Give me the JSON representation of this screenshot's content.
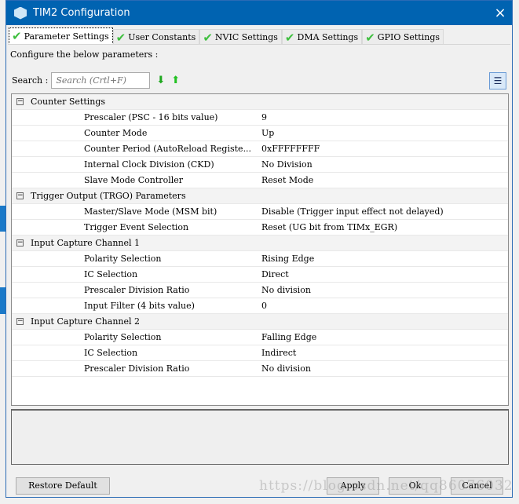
{
  "window": {
    "title": "TIM2 Configuration",
    "close_icon": "×"
  },
  "tabs": [
    {
      "label": "Parameter Settings"
    },
    {
      "label": "User Constants"
    },
    {
      "label": "NVIC Settings"
    },
    {
      "label": "DMA Settings"
    },
    {
      "label": "GPIO Settings"
    }
  ],
  "config_label": "Configure the below parameters :",
  "search": {
    "label": "Search :",
    "placeholder": "Search (Crtl+F)"
  },
  "groups": [
    {
      "title": "Counter Settings",
      "rows": [
        [
          "Prescaler (PSC - 16 bits value)",
          "9"
        ],
        [
          "Counter Mode",
          "Up"
        ],
        [
          "Counter Period (AutoReload Registe...",
          "0xFFFFFFFF"
        ],
        [
          "Internal Clock Division (CKD)",
          "No Division"
        ],
        [
          "Slave Mode Controller",
          "Reset Mode"
        ]
      ]
    },
    {
      "title": "Trigger Output (TRGO) Parameters",
      "rows": [
        [
          "Master/Slave Mode (MSM bit)",
          "Disable (Trigger input effect not delayed)"
        ],
        [
          "Trigger Event Selection",
          "Reset (UG bit from TIMx_EGR)"
        ]
      ]
    },
    {
      "title": "Input Capture Channel 1",
      "rows": [
        [
          "Polarity Selection",
          "Rising Edge"
        ],
        [
          "IC Selection",
          "Direct"
        ],
        [
          "Prescaler Division Ratio",
          "No division"
        ],
        [
          "Input Filter (4 bits value)",
          "0"
        ]
      ]
    },
    {
      "title": "Input Capture Channel 2",
      "rows": [
        [
          "Polarity Selection",
          "Falling Edge"
        ],
        [
          "IC Selection",
          "Indirect"
        ],
        [
          "Prescaler Division Ratio",
          "No division"
        ]
      ]
    }
  ],
  "buttons": {
    "restore": "Restore Default",
    "apply": "Apply",
    "ok": "Ok",
    "cancel": "Cancel"
  },
  "watermark": "https://blog.csdn.net/qq86076032"
}
